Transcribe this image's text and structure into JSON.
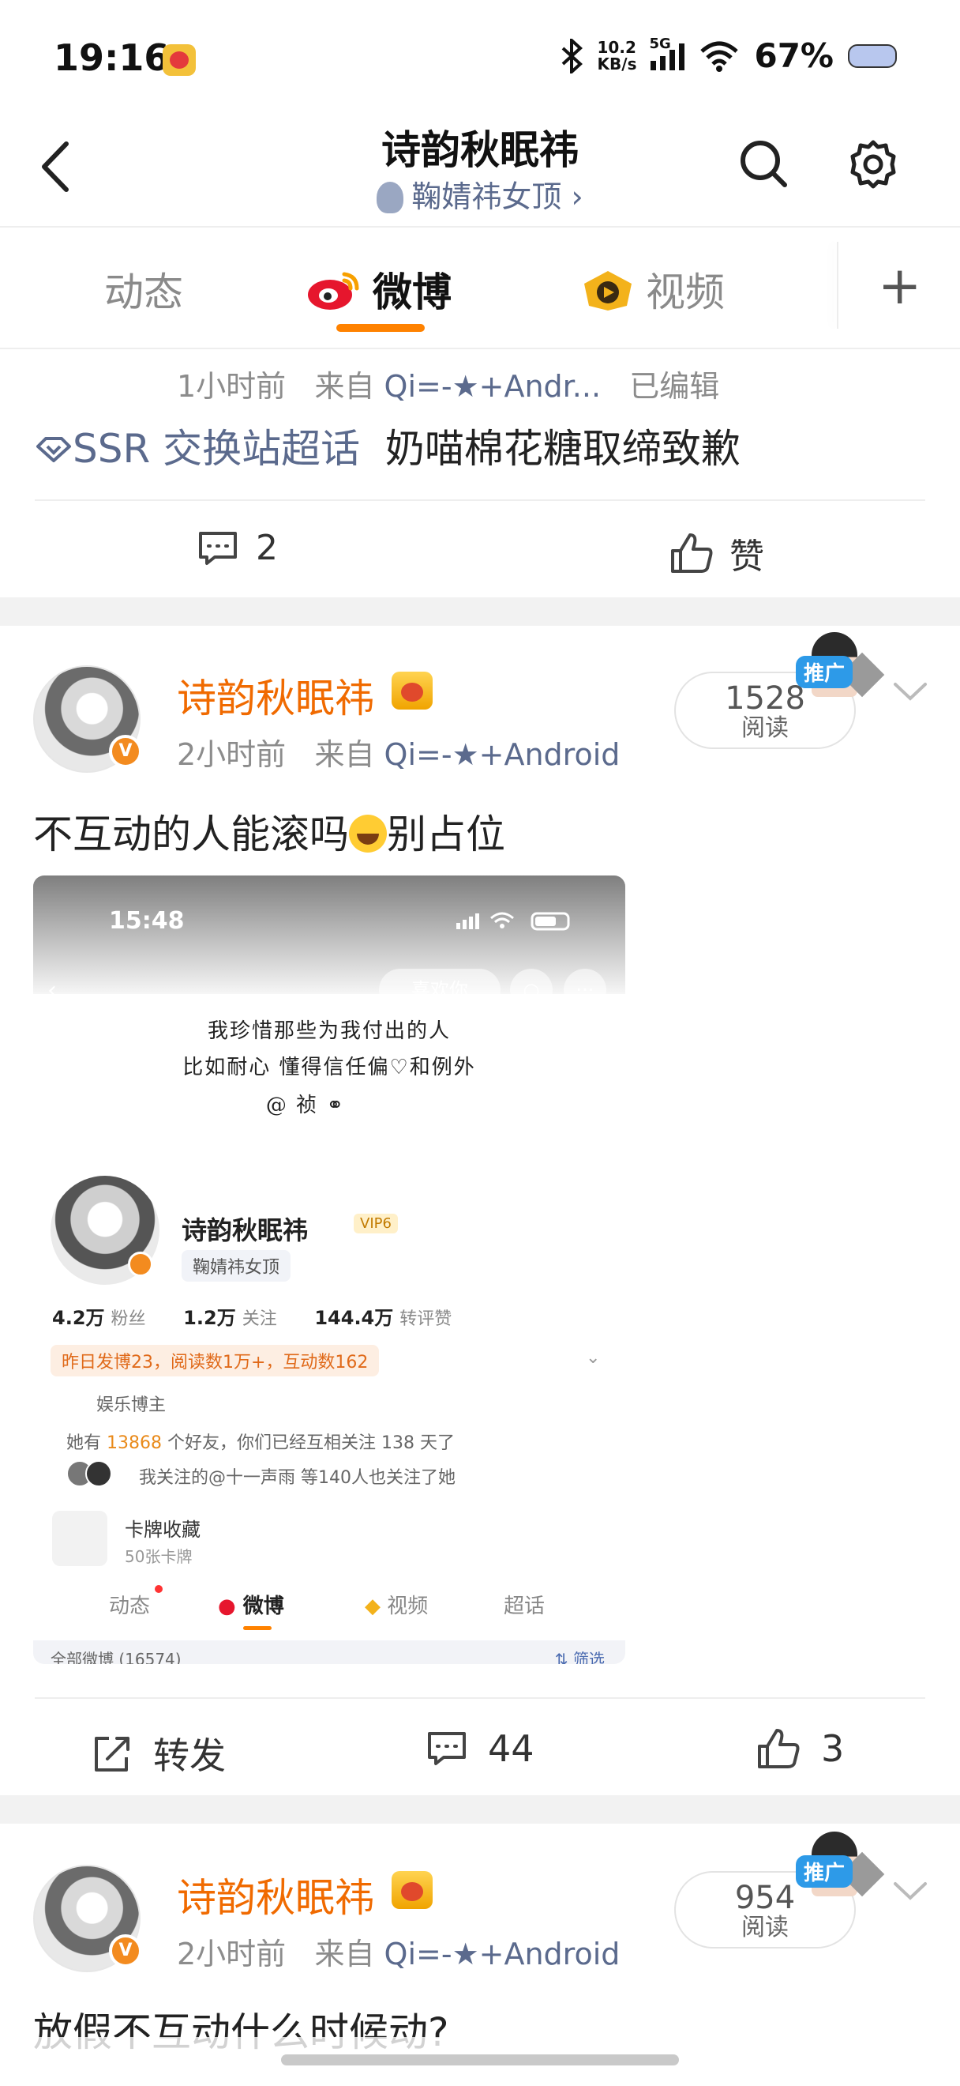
{
  "status_bar": {
    "time": "19:16",
    "app_icon": "weibo-notification-icon",
    "net_speed_value": "10.2",
    "net_speed_unit": "KB/s",
    "network": "5G",
    "battery": "67%"
  },
  "header": {
    "title": "诗韵秋眠祎",
    "subtitle": "鞠婧祎女顶",
    "subtitle_chevron": "›"
  },
  "tabs": [
    {
      "label": "动态",
      "active": false
    },
    {
      "label": "微博",
      "active": true
    },
    {
      "label": "视频",
      "active": false
    }
  ],
  "tab_add": "+",
  "accent_color": "#ff8200",
  "posts": [
    {
      "time": "1小时前",
      "from_label": "来自",
      "source": "Qi=-★+Andr...",
      "edited": "已编辑",
      "topic": "SSR 交换站超话",
      "text": "奶喵棉花糖取缔致歉",
      "comments": "2",
      "like_label": "赞"
    },
    {
      "author": "诗韵秋眠祎",
      "time": "2小时前",
      "from_label": "来自",
      "source": "Qi=-★+Android",
      "reads": "1528",
      "reads_label": "阅读",
      "promo": "推广",
      "text": "不互动的人能滚吗",
      "text_after": "别占位",
      "repost_label": "转发",
      "comments": "44",
      "likes": "3",
      "image": {
        "time": "15:48",
        "like_you": "喜欢你",
        "handwriting": [
          "我珍惜那些为我付出的人",
          "比如耐心 懂得信任偏♡和例外",
          "@ 祯 ⚭"
        ],
        "name": "诗韵秋眠祎",
        "vip": "VIP6",
        "tag": "鞠婧祎女顶",
        "stats": [
          {
            "value": "4.2万",
            "label": "粉丝"
          },
          {
            "value": "1.2万",
            "label": "关注"
          },
          {
            "value": "144.4万",
            "label": "转评赞"
          }
        ],
        "yesterday": "昨日发博23，阅读数1万+，互动数162",
        "role": "娱乐博主",
        "friends_pre": "她有",
        "friends_num": "13868",
        "friends_post": "个好友，你们已经互相关注 138 天了",
        "mutual": "我关注的@十一声雨 等140人也关注了她",
        "card_title": "卡牌收藏",
        "card_sub": "50张卡牌",
        "tabs": [
          "动态",
          "微博",
          "视频",
          "超话"
        ],
        "all_weibo": "全部微博 (16574)",
        "filter": "筛选"
      }
    },
    {
      "author": "诗韵秋眠祎",
      "time": "2小时前",
      "from_label": "来自",
      "source": "Qi=-★+Android",
      "reads": "954",
      "reads_label": "阅读",
      "promo": "推广",
      "text": "放假不互动什么时候动?"
    }
  ]
}
